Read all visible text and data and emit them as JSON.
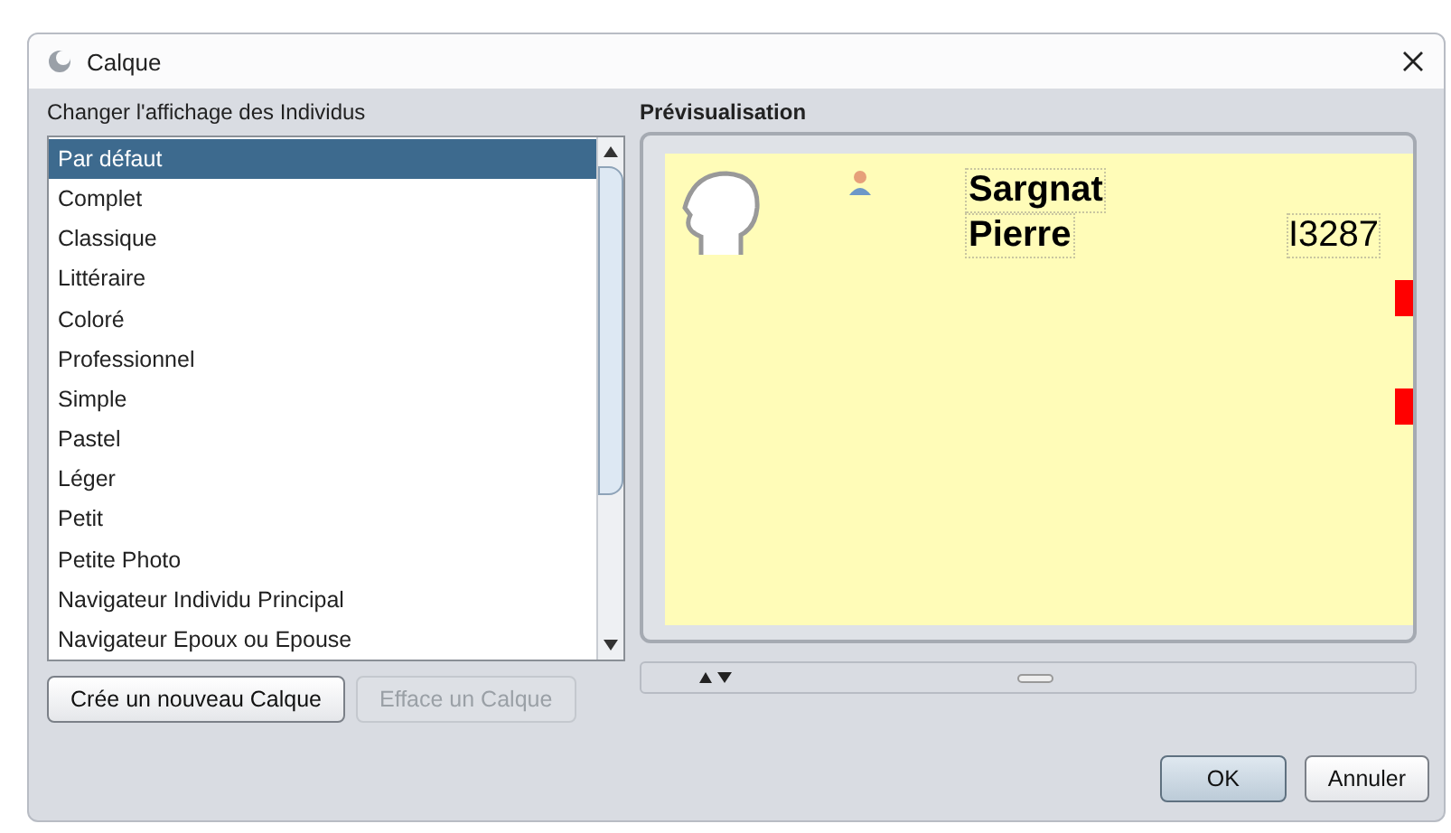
{
  "window": {
    "title": "Calque"
  },
  "list_label": "Changer l'affichage des Individus",
  "styles": [
    {
      "label": "Par défaut",
      "selected": true
    },
    {
      "label": "Complet",
      "selected": false
    },
    {
      "label": "Classique",
      "selected": false
    },
    {
      "label": "Littéraire",
      "selected": false
    },
    {
      "label": "Coloré",
      "selected": false
    },
    {
      "label": "Professionnel",
      "selected": false
    },
    {
      "label": "Simple",
      "selected": false
    },
    {
      "label": "Pastel",
      "selected": false
    },
    {
      "label": "Léger",
      "selected": false
    },
    {
      "label": "Petit",
      "selected": false
    },
    {
      "label": "Petite Photo",
      "selected": false
    },
    {
      "label": "Navigateur Individu Principal",
      "selected": false
    },
    {
      "label": "Navigateur Epoux ou Epouse",
      "selected": false
    }
  ],
  "list_buttons": [
    {
      "label": "Crée un nouveau Calque",
      "disabled": false
    },
    {
      "label": "Efface un Calque",
      "disabled": true
    }
  ],
  "preview": {
    "title": "Prévisualisation",
    "surname": "Sargnat",
    "given_name": "Pierre",
    "id": "I3287"
  },
  "dialog_buttons": [
    {
      "label": "OK",
      "default": true
    },
    {
      "label": "Annuler",
      "default": false
    }
  ]
}
